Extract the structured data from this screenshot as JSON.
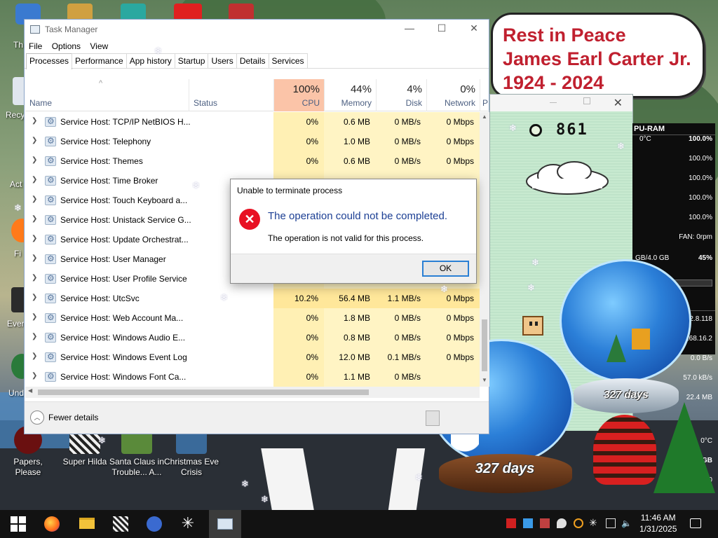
{
  "desktop": {
    "icons": [
      {
        "label": "Papers, Please"
      },
      {
        "label": "Super Hilda"
      },
      {
        "label": "Santa Claus in Trouble... A..."
      },
      {
        "label": "Christmas Eve Crisis"
      }
    ],
    "left_partial_labels": [
      "Th",
      "Recy",
      "Act",
      "Fi",
      "Ever",
      "Und"
    ]
  },
  "memorial": {
    "line1": "Rest in Peace",
    "line2": "James Earl Carter Jr.",
    "line3": "1924 - 2024"
  },
  "game_window": {
    "counter": "861",
    "close": "✕"
  },
  "sysmon": {
    "cpu_header": "PU-RAM",
    "temp": "0°C",
    "cpu_total": "100.0%",
    "cores": [
      "100.0%",
      "100.0%",
      "100.0%",
      "100.0%"
    ],
    "fan": "FAN: 0rpm",
    "ram": "GB/4.0 GB",
    "ram_pct": "45%",
    "net_header": "ETWORK",
    "ip1": "23.162.8.118",
    "ip2": "192.168.16.2",
    "rate1": "0.0 B/s",
    "rate2": "57.0 kB/s",
    "rate3": "22.4 MB",
    "disk_temp": "0°C",
    "disk": "9.5 GB",
    "disk2": "0.0"
  },
  "globes": {
    "days_big": "327 days",
    "days_small": "327 days"
  },
  "task_manager": {
    "title": "Task Manager",
    "window_controls": {
      "minimize": "—",
      "maximize": "☐",
      "close": "✕"
    },
    "menu": [
      "File",
      "Options",
      "View"
    ],
    "tabs": [
      "Processes",
      "Performance",
      "App history",
      "Startup",
      "Users",
      "Details",
      "Services"
    ],
    "active_tab": "Processes",
    "columns": {
      "name": "Name",
      "status": "Status",
      "cpu_pct": "100%",
      "cpu": "CPU",
      "mem_pct": "44%",
      "mem": "Memory",
      "disk_pct": "4%",
      "disk": "Disk",
      "net_pct": "0%",
      "net": "Network",
      "power": "P"
    },
    "rows": [
      {
        "name": "Service Host: TCP/IP NetBIOS H...",
        "cpu": "0%",
        "mem": "0.6 MB",
        "disk": "0 MB/s",
        "net": "0 Mbps"
      },
      {
        "name": "Service Host: Telephony",
        "cpu": "0%",
        "mem": "1.0 MB",
        "disk": "0 MB/s",
        "net": "0 Mbps"
      },
      {
        "name": "Service Host: Themes",
        "cpu": "0%",
        "mem": "0.6 MB",
        "disk": "0 MB/s",
        "net": "0 Mbps"
      },
      {
        "name": "Service Host: Time Broker",
        "cpu": "",
        "mem": "",
        "disk": "",
        "net": ""
      },
      {
        "name": "Service Host: Touch Keyboard a...",
        "cpu": "",
        "mem": "",
        "disk": "",
        "net": ""
      },
      {
        "name": "Service Host: Unistack Service G...",
        "cpu": "",
        "mem": "",
        "disk": "",
        "net": ""
      },
      {
        "name": "Service Host: Update Orchestrat...",
        "cpu": "",
        "mem": "",
        "disk": "",
        "net": ""
      },
      {
        "name": "Service Host: User Manager",
        "cpu": "",
        "mem": "",
        "disk": "",
        "net": ""
      },
      {
        "name": "Service Host: User Profile Service",
        "cpu": "",
        "mem": "",
        "disk": "",
        "net": ""
      },
      {
        "name": "Service Host: UtcSvc",
        "cpu": "10.2%",
        "mem": "56.4 MB",
        "disk": "1.1 MB/s",
        "net": "0 Mbps"
      },
      {
        "name": "Service Host: Web Account Ma...",
        "cpu": "0%",
        "mem": "1.8 MB",
        "disk": "0 MB/s",
        "net": "0 Mbps"
      },
      {
        "name": "Service Host: Windows Audio E...",
        "cpu": "0%",
        "mem": "0.8 MB",
        "disk": "0 MB/s",
        "net": "0 Mbps"
      },
      {
        "name": "Service Host: Windows Event Log",
        "cpu": "0%",
        "mem": "12.0 MB",
        "disk": "0.1 MB/s",
        "net": "0 Mbps"
      },
      {
        "name": "Service Host: Windows Font Ca...",
        "cpu": "0%",
        "mem": "1.1 MB",
        "disk": "0 MB/s",
        "net": ""
      }
    ],
    "fewer_details": "Fewer details"
  },
  "dialog": {
    "title": "Unable to terminate process",
    "main": "The operation could not be completed.",
    "sub": "The operation is not valid for this process.",
    "ok": "OK"
  },
  "taskbar": {
    "time": "11:46 AM",
    "date": "1/31/2025"
  }
}
